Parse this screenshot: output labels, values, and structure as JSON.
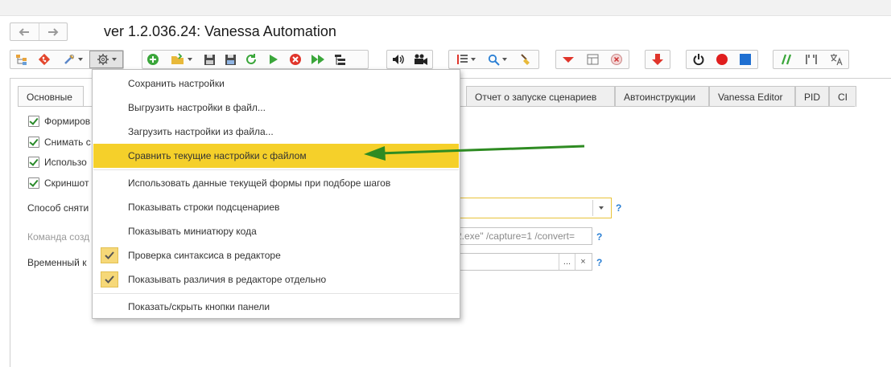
{
  "window": {
    "title": "ver 1.2.036.24: Vanessa Automation"
  },
  "nav": {
    "back_icon": "arrow-left-icon",
    "forward_icon": "arrow-right-icon"
  },
  "toolbar": {
    "groups": [
      [
        "tree-icon",
        "git-icon",
        "tools-icon",
        "gear-icon"
      ],
      [
        "add-icon",
        "open-folder-icon",
        "save-icon",
        "save-as-icon",
        "refresh-icon",
        "play-icon",
        "stop-icon",
        "fast-forward-icon",
        "steps-icon"
      ],
      [
        "sound-icon",
        "camera-icon"
      ],
      [
        "list-icon",
        "search-icon",
        "brush-icon"
      ],
      [
        "collapse-icon",
        "table-icon",
        "clear-icon"
      ],
      [
        "download-icon"
      ],
      [
        "power-icon",
        "record-icon",
        "stop-record-icon"
      ],
      [
        "comment-icon",
        "quotes-icon",
        "translate-icon"
      ]
    ]
  },
  "tabs": [
    {
      "label": "Основные"
    },
    {
      "label": "Отчет о запуске сценариев"
    },
    {
      "label": "Автоинструкции"
    },
    {
      "label": "Vanessa Editor"
    },
    {
      "label": "PID"
    },
    {
      "label": "CI"
    }
  ],
  "form": {
    "checkboxes": [
      {
        "label": "Формиров",
        "checked": true
      },
      {
        "label": "Снимать с",
        "checked": true
      },
      {
        "label": "Использо",
        "checked": true
      },
      {
        "label": "Скриншот",
        "checked": true
      }
    ],
    "method_label": "Способ сняти",
    "command_label": "Команда созд",
    "command_value": "2.exe\" /capture=1 /convert=",
    "temp_label": "Временный к",
    "help_mark": "?",
    "select_btn": "...",
    "clear_btn": "×"
  },
  "context_menu": {
    "items": [
      {
        "label": "Сохранить настройки",
        "checked": false,
        "highlighted": false
      },
      {
        "label": "Выгрузить настройки в файл...",
        "checked": false,
        "highlighted": false
      },
      {
        "label": "Загрузить настройки из файла...",
        "checked": false,
        "highlighted": false
      },
      {
        "label": "Сравнить текущие настройки с файлом",
        "checked": false,
        "highlighted": true
      },
      {
        "label": "Использовать данные текущей формы при подборе шагов",
        "checked": false,
        "highlighted": false
      },
      {
        "label": "Показывать строки подсценариев",
        "checked": false,
        "highlighted": false
      },
      {
        "label": "Показывать миниатюру кода",
        "checked": false,
        "highlighted": false
      },
      {
        "label": "Проверка синтаксиса в редакторе",
        "checked": true,
        "highlighted": false
      },
      {
        "label": "Показывать различия в редакторе отдельно",
        "checked": true,
        "highlighted": false
      },
      {
        "label": "Показать/скрыть кнопки панели",
        "checked": false,
        "highlighted": false
      }
    ]
  },
  "colors": {
    "highlight": "#f5d02a",
    "annotation_arrow": "#2e8b22",
    "accent_green": "#3aa63a",
    "accent_red": "#e0352b",
    "accent_blue": "#2a7fd4"
  }
}
